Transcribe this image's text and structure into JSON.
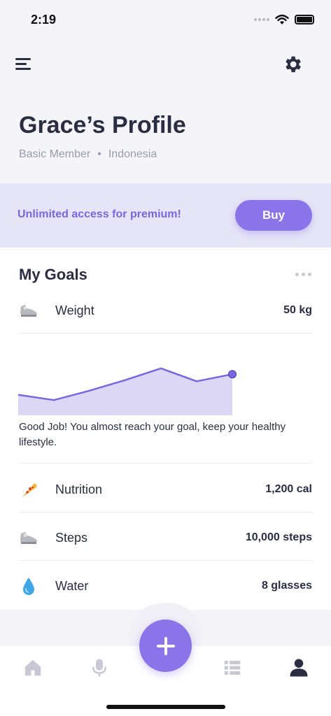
{
  "status_bar": {
    "time": "2:19"
  },
  "profile": {
    "title": "Grace’s Profile",
    "membership": "Basic Member",
    "separator": "•",
    "country": "Indonesia"
  },
  "premium": {
    "text": "Unlimited access for premium!",
    "button_label": "Buy"
  },
  "goals": {
    "title": "My Goals",
    "weight": {
      "label": "Weight",
      "value": "50 kg",
      "icon": "shoe-icon"
    },
    "message": "Good Job! You almost reach your goal, keep your healthy lifestyle.",
    "items": [
      {
        "label": "Nutrition",
        "value": "1,200 cal",
        "icon": "pizza-icon"
      },
      {
        "label": "Steps",
        "value": "10,000 steps",
        "icon": "shoe-icon"
      },
      {
        "label": "Water",
        "value": "8 glasses",
        "icon": "water-drop-icon"
      }
    ]
  },
  "chart_data": {
    "type": "area",
    "x": [
      0,
      1,
      2,
      3,
      4,
      5,
      6
    ],
    "values": [
      3.5,
      2.6,
      4.2,
      6.0,
      8.0,
      5.8,
      7.0
    ],
    "ylim": [
      0,
      10
    ],
    "color": "#7a66e0",
    "fill": "#dcd7f4",
    "title": "",
    "xlabel": "",
    "ylabel": ""
  },
  "tabbar": {
    "tabs": [
      "home-icon",
      "microphone-icon",
      "list-icon",
      "profile-icon"
    ],
    "active_tab": "profile-icon",
    "fab_icon": "plus-icon"
  },
  "colors": {
    "accent": "#8b74ea",
    "premium_bg": "#e6e4f7",
    "text": "#2b2d42",
    "muted": "#9a9bb0"
  }
}
